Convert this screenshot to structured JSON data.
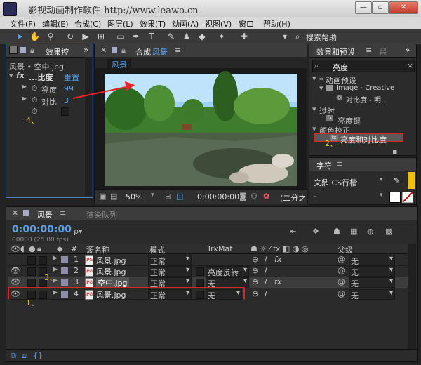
{
  "window": {
    "title": "影视动画制作软件    http://www.leawo.cn"
  },
  "menu": [
    "文件(F)",
    "编辑(E)",
    "合成(C)",
    "图层(L)",
    "效果(T)",
    "动画(A)",
    "视图(V)",
    "窗口",
    "帮助(H)"
  ],
  "toolbar": {
    "search_help": "搜索帮助"
  },
  "effect_controls": {
    "tab": "效果控",
    "subtitle": "风景 • 空中.jpg",
    "effect_name": "...比度",
    "reset": "重置",
    "params": [
      {
        "name": "亮度",
        "value": "99"
      },
      {
        "name": "对比",
        "value": "3"
      }
    ]
  },
  "composition": {
    "tab_prefix": "合成",
    "tab_name": "风景",
    "comp_chip": "风景",
    "zoom": "50%",
    "timecode": "0:00:00:00",
    "view_label": "(二分之"
  },
  "effects_presets": {
    "tab": "效果和预设",
    "tab2": "段",
    "search_value": "亮度",
    "tree": [
      {
        "label": "* 动画预设",
        "level": 0
      },
      {
        "label": "Image - Creative",
        "level": 1
      },
      {
        "label": "对比度 - 明...",
        "level": 2
      },
      {
        "label": "过时",
        "level": 0
      },
      {
        "label": "亮度键",
        "level": 1
      },
      {
        "label": "颜色校正",
        "level": 0
      },
      {
        "label": "亮度和对比度",
        "level": 1
      }
    ]
  },
  "character": {
    "tab": "字符",
    "font": "文鼎 CS行楷",
    "style": "-"
  },
  "timeline": {
    "tab": "风景",
    "render_tab": "渲染队列",
    "timecode": "0:00:00:00",
    "fps": "00000 (25.00 fps)",
    "search_placeholder": "ρ▾",
    "headers": {
      "num": "#",
      "source": "源名称",
      "mode": "模式",
      "trkmat": "TrkMat",
      "parent": "父级"
    },
    "layers": [
      {
        "num": "1",
        "name": "风景.jpg",
        "mode": "正常",
        "trkmat": "",
        "parent": "无",
        "fx": true
      },
      {
        "num": "2",
        "name": "风景.jpg",
        "mode": "正常",
        "trkmat": "亮度反转",
        "parent": "无",
        "fx": false
      },
      {
        "num": "3",
        "name": "空中.jpg",
        "mode": "正常",
        "trkmat": "无",
        "parent": "无",
        "fx": true
      },
      {
        "num": "4",
        "name": "风景.jpg",
        "mode": "正常",
        "trkmat": "无",
        "parent": "无",
        "fx": false
      }
    ]
  },
  "annotations": {
    "one": "1、",
    "two": "2、",
    "three": "3、",
    "four": "4、"
  },
  "colors": {
    "accent_blue": "#5aa0ea",
    "annotation_red": "#d42828",
    "annotation_yellow": "#e6d53c",
    "swatch_yellow": "#f0c000"
  }
}
